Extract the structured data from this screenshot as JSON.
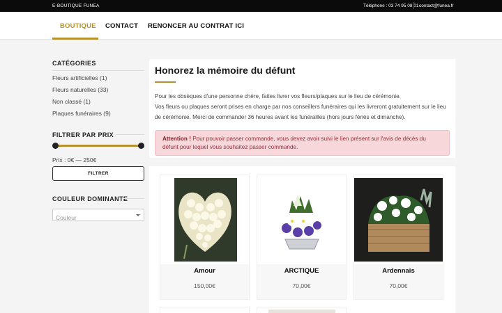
{
  "topbar": {
    "brand": "E-BOUTIQUE FUNEA",
    "phone": "Téléphone : 03 74 95 08 01",
    "email": "contact@funea.fr"
  },
  "nav": {
    "items": [
      {
        "label": "BOUTIQUE",
        "active": true
      },
      {
        "label": "CONTACT",
        "active": false
      },
      {
        "label": "RENONCER AU CONTRAT ICI",
        "active": false
      }
    ]
  },
  "sidebar": {
    "categories_title": "CATÉGORIES",
    "categories": [
      {
        "label": "Fleurs artificielles",
        "count": "(1)"
      },
      {
        "label": "Fleurs naturelles",
        "count": "(33)"
      },
      {
        "label": "Non classé",
        "count": "(1)"
      },
      {
        "label": "Plaques funéraires",
        "count": "(9)"
      }
    ],
    "price_title": "FILTRER PAR PRIX",
    "price_label": "Prix : 0€ — 250€",
    "filter_button": "FILTRER",
    "color_title": "COULEUR DOMINANTE",
    "color_placeholder": "Couleur"
  },
  "intro": {
    "title": "Honorez la mémoire du défunt",
    "line1": "Pour les obsèques d'une personne chère, faites livrer vos fleurs/plaques sur le lieu de cérémonie.",
    "line2": "Vos fleurs ou plaques seront prises en charge par nos conseillers funéraires qui les livreront gratuitement sur le lieu de cérémonie. Merci de commander 36 heures avant les funérailles (hors jours fériés et dimanche).",
    "alert_strong": "Attention !",
    "alert_text": " Pour pouvoir passer commande, vous devez avoir suivi le lien présent sur l'avis de décès du défunt pour lequel vous souhaitez passer commande."
  },
  "products": [
    {
      "name": "Amour",
      "price": "150,00€",
      "image": "heart-white-roses"
    },
    {
      "name": "ARCTIQUE",
      "price": "70,00€",
      "image": "basket-purple-white"
    },
    {
      "name": "Ardennais",
      "price": "70,00€",
      "image": "wicker-basket-white-flowers"
    }
  ],
  "colors": {
    "accent": "#b8912f",
    "topbar": "#0b0b0b",
    "alert_bg": "#f8d7da",
    "alert_text": "#9b2d3a"
  }
}
